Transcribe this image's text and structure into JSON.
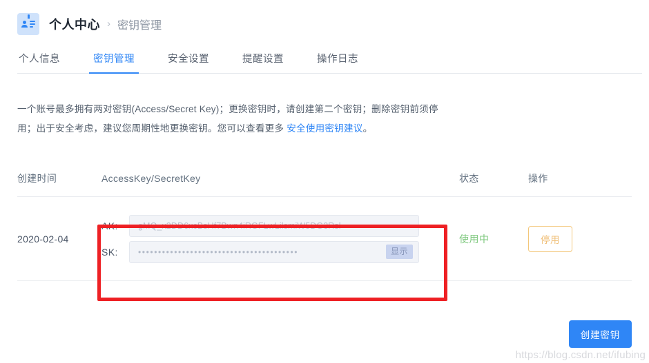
{
  "header": {
    "icon": "id-badge-icon",
    "title": "个人中心",
    "separator": "›",
    "subtitle": "密钥管理"
  },
  "tabs": [
    {
      "label": "个人信息",
      "active": false
    },
    {
      "label": "密钥管理",
      "active": true
    },
    {
      "label": "安全设置",
      "active": false
    },
    {
      "label": "提醒设置",
      "active": false
    },
    {
      "label": "操作日志",
      "active": false
    }
  ],
  "description": {
    "text_before": "一个账号最多拥有两对密钥(Access/Secret Key)；更换密钥时，请创建第二个密钥；删除密钥前须停用；出于安全考虑，建议您周期性地更换密钥。您可以查看更多 ",
    "link_label": "安全使用密钥建议",
    "text_after": "。"
  },
  "table": {
    "columns": {
      "time": "创建时间",
      "keys": "AccessKey/SecretKey",
      "state": "状态",
      "action": "操作"
    },
    "rows": [
      {
        "created_at": "2020-02-04",
        "ak_label": "AK:",
        "ak_value": "gMQ_x2DD6xcBsHf7Bwn4iRGFLwLilsmiW5DG3Rsl",
        "sk_label": "SK:",
        "sk_value": "••••••••••••••••••••••••••••••••••••••••",
        "show_button": "显示",
        "status": "使用中",
        "action_button": "停用"
      }
    ]
  },
  "footer": {
    "create_button": "创建密钥"
  },
  "watermark": "https://blog.csdn.net/ifubing",
  "colors": {
    "accent": "#2f86f6",
    "status_active": "#7ec87e",
    "warn_outline": "#f3c77a",
    "annotation_red": "#ee2024",
    "field_bg": "#f2f4f8",
    "show_btn_bg": "#c8d3ef"
  }
}
